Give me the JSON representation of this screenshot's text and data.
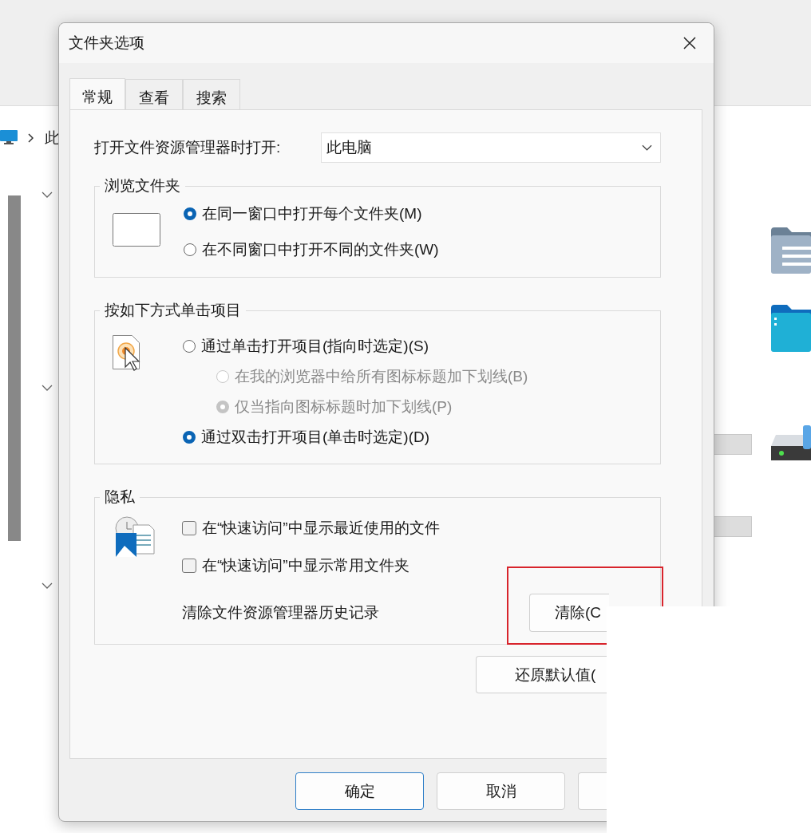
{
  "explorer": {
    "breadcrumb": "此"
  },
  "window": {
    "title": "文件夹选项"
  },
  "tabs": [
    {
      "label": "常规",
      "selected": true
    },
    {
      "label": "查看",
      "selected": false
    },
    {
      "label": "搜索",
      "selected": false
    }
  ],
  "open_in": {
    "label": "打开文件资源管理器时打开:",
    "value": "此电脑"
  },
  "browse_group": {
    "title": "浏览文件夹",
    "options": [
      {
        "label": "在同一窗口中打开每个文件夹(M)",
        "selected": true
      },
      {
        "label": "在不同窗口中打开不同的文件夹(W)",
        "selected": false
      }
    ]
  },
  "click_group": {
    "title": "按如下方式单击项目",
    "options": [
      {
        "label": "通过单击打开项目(指向时选定)(S)",
        "selected": false,
        "disabled": false,
        "children": [
          {
            "label": "在我的浏览器中给所有图标标题加下划线(B)",
            "selected": false,
            "disabled": true
          },
          {
            "label": "仅当指向图标标题时加下划线(P)",
            "selected": true,
            "disabled": true
          }
        ]
      },
      {
        "label": "通过双击打开项目(单击时选定)(D)",
        "selected": true,
        "disabled": false
      }
    ]
  },
  "privacy_group": {
    "title": "隐私",
    "checkboxes": [
      {
        "label": "在“快速访问”中显示最近使用的文件",
        "checked": false
      },
      {
        "label": "在“快速访问”中显示常用文件夹",
        "checked": false
      }
    ],
    "clear_label": "清除文件资源管理器历史记录",
    "clear_button": "清除(C"
  },
  "restore_button": "还原默认值(",
  "buttons": [
    {
      "label": "确定",
      "default": true
    },
    {
      "label": "取消",
      "default": false
    }
  ]
}
